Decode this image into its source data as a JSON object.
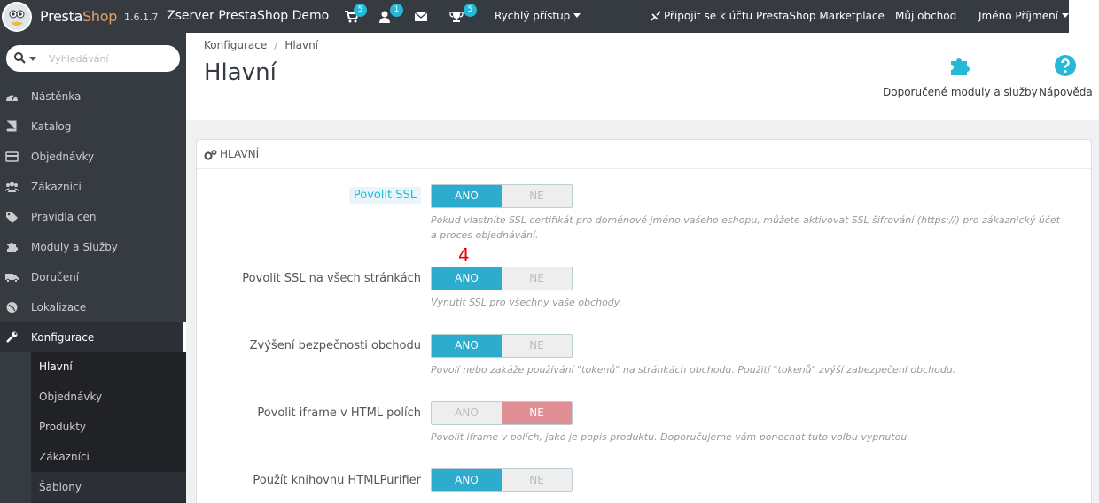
{
  "topbar": {
    "brand_presta": "Presta",
    "brand_shop": "Shop",
    "version": "1.6.1.7",
    "shop_name": "Zserver PrestaShop Demo",
    "badges": {
      "orders": "5",
      "customers": "1",
      "trophies": "5"
    },
    "quick_access": "Rychlý přístup",
    "marketplace": "Připojit se k účtu PrestaShop Marketplace",
    "my_shop": "Můj obchod",
    "user": "Jméno Příjmení"
  },
  "sidebar": {
    "search_placeholder": "Vyhledávání",
    "items": [
      {
        "label": "Nástěnka",
        "icon": "dashboard-icon"
      },
      {
        "label": "Katalog",
        "icon": "book-icon"
      },
      {
        "label": "Objednávky",
        "icon": "credit-card-icon"
      },
      {
        "label": "Zákazníci",
        "icon": "users-icon"
      },
      {
        "label": "Pravidla cen",
        "icon": "tags-icon"
      },
      {
        "label": "Moduly a Služby",
        "icon": "puzzle-icon"
      },
      {
        "label": "Doručení",
        "icon": "truck-icon"
      },
      {
        "label": "Lokalizace",
        "icon": "globe-icon"
      },
      {
        "label": "Konfigurace",
        "icon": "wrench-icon"
      }
    ],
    "subitems": [
      "Hlavní",
      "Objednávky",
      "Produkty",
      "Zákazníci",
      "Šablony"
    ]
  },
  "header": {
    "breadcrumb": [
      "Konfigurace",
      "Hlavní"
    ],
    "title": "Hlavní",
    "recommended": "Doporučené moduly a služby",
    "help": "Nápověda"
  },
  "panel": {
    "title": "HLAVNÍ",
    "yes": "ANO",
    "no": "NE",
    "annotation": "4",
    "fields": [
      {
        "label": "Povolit SSL",
        "value": "ANO",
        "help": "Pokud vlastníte SSL certifikát pro doménové jméno vašeho eshopu, můžete aktivovat SSL šifrování (https://) pro zákaznický účet a proces objednávání."
      },
      {
        "label": "Povolit SSL na všech stránkách",
        "value": "ANO",
        "help": "Vynutit SSL pro všechny vaše obchody."
      },
      {
        "label": "Zvýšení bezpečnosti obchodu",
        "value": "ANO",
        "help": "Povolí nebo zakáže používání \"tokenů\" na stránkách obchodu. Použití \"tokenů\" zvýší zabezpečení obchodu."
      },
      {
        "label": "Povolit iframe v HTML polích",
        "value": "NE",
        "help": "Povolit iframe v polích, jako je popis produktu. Doporučujeme vám ponechat tuto volbu vypnutou."
      },
      {
        "label": "Použít knihovnu HTMLPurifier",
        "value": "ANO",
        "help": ""
      }
    ]
  },
  "colors": {
    "accent": "#25b9d7",
    "switch_on": "#2eacce",
    "switch_off_red": "#e08f95",
    "dark": "#363a41"
  }
}
